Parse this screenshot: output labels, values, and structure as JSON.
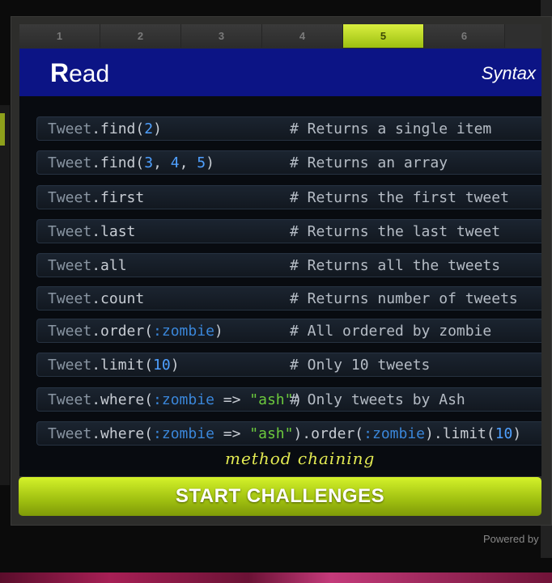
{
  "steps": [
    "1",
    "2",
    "3",
    "4",
    "5",
    "6"
  ],
  "active_step": "5",
  "header": {
    "title_first": "R",
    "title_rest": "ead",
    "subtitle": "Syntax"
  },
  "rows": [
    {
      "code": [
        [
          "Tweet",
          "kw"
        ],
        [
          ".find(",
          ""
        ],
        [
          "2",
          "num"
        ],
        [
          ")",
          ""
        ]
      ],
      "comment": "# Returns a single item"
    },
    {
      "code": [
        [
          "Tweet",
          "kw"
        ],
        [
          ".find(",
          ""
        ],
        [
          "3",
          "num"
        ],
        [
          ", ",
          ""
        ],
        [
          "4",
          "num"
        ],
        [
          ", ",
          ""
        ],
        [
          "5",
          "num"
        ],
        [
          ")",
          ""
        ]
      ],
      "comment": "# Returns an array"
    },
    {
      "code": [
        [
          "Tweet",
          "kw"
        ],
        [
          ".first",
          ""
        ]
      ],
      "comment": "# Returns the first tweet"
    },
    {
      "code": [
        [
          "Tweet",
          "kw"
        ],
        [
          ".last",
          ""
        ]
      ],
      "comment": "# Returns the last tweet"
    },
    {
      "code": [
        [
          "Tweet",
          "kw"
        ],
        [
          ".all",
          ""
        ]
      ],
      "comment": "# Returns all the tweets"
    },
    {
      "code": [
        [
          "Tweet",
          "kw"
        ],
        [
          ".count",
          ""
        ]
      ],
      "comment": "# Returns number of tweets"
    },
    {
      "code": [
        [
          "Tweet",
          "kw"
        ],
        [
          ".order(",
          ""
        ],
        [
          ":zombie",
          "sym"
        ],
        [
          ")",
          ""
        ]
      ],
      "comment": "# All ordered by zombie"
    },
    {
      "code": [
        [
          "Tweet",
          "kw"
        ],
        [
          ".limit(",
          ""
        ],
        [
          "10",
          "num"
        ],
        [
          ")",
          ""
        ]
      ],
      "comment": "# Only 10 tweets"
    },
    {
      "code": [
        [
          "Tweet",
          "kw"
        ],
        [
          ".where(",
          ""
        ],
        [
          ":zombie",
          "sym"
        ],
        [
          " => ",
          ""
        ],
        [
          "\"ash\"",
          "str"
        ],
        [
          ")",
          ""
        ]
      ],
      "comment": "# Only tweets by Ash"
    },
    {
      "code": [
        [
          "Tweet",
          "kw"
        ],
        [
          ".where(",
          ""
        ],
        [
          ":zombie",
          "sym"
        ],
        [
          " => ",
          ""
        ],
        [
          "\"ash\"",
          "str"
        ],
        [
          ").order(",
          ""
        ],
        [
          ":zombie",
          "sym"
        ],
        [
          ").limit(",
          ""
        ],
        [
          "10",
          "num"
        ],
        [
          ")",
          ""
        ]
      ],
      "comment": ""
    }
  ],
  "annotation": "method chaining",
  "start_button": "START CHALLENGES",
  "powered_by": "Powered by",
  "colors": {
    "accent": "#b5d91a",
    "header_bg": "#0c1485",
    "number": "#4fa0ff",
    "symbol": "#3a86d9",
    "string": "#6cc93d"
  }
}
